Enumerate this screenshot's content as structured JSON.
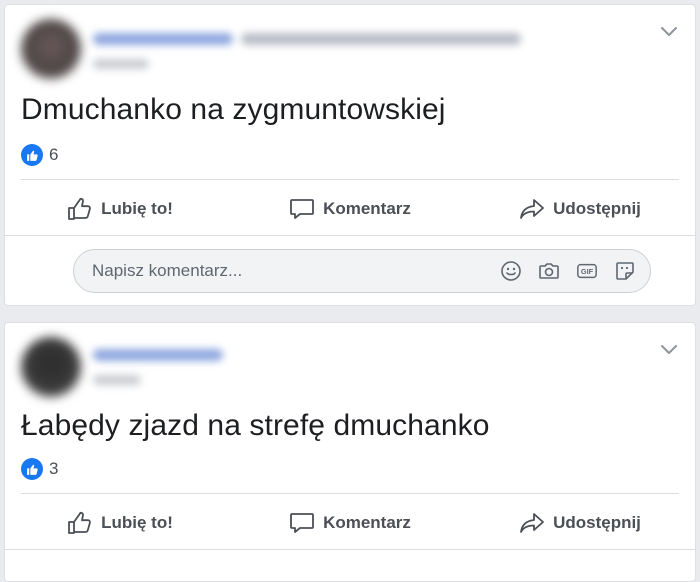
{
  "posts": [
    {
      "text": "Dmuchanko na zygmuntowskiej",
      "like_count": "6",
      "actions": {
        "like": "Lubię to!",
        "comment": "Komentarz",
        "share": "Udostępnij"
      },
      "comment_placeholder": "Napisz komentarz..."
    },
    {
      "text": "Łabędy zjazd na strefę dmuchanko",
      "like_count": "3",
      "actions": {
        "like": "Lubię to!",
        "comment": "Komentarz",
        "share": "Udostępnij"
      }
    }
  ],
  "icons": {
    "comment_box": [
      "emoji-icon",
      "camera-icon",
      "gif-icon",
      "sticker-icon"
    ]
  },
  "colors": {
    "accent": "#1877f2",
    "background": "#e9ebee",
    "text": "#1c1e21",
    "muted": "#4b4f56"
  }
}
